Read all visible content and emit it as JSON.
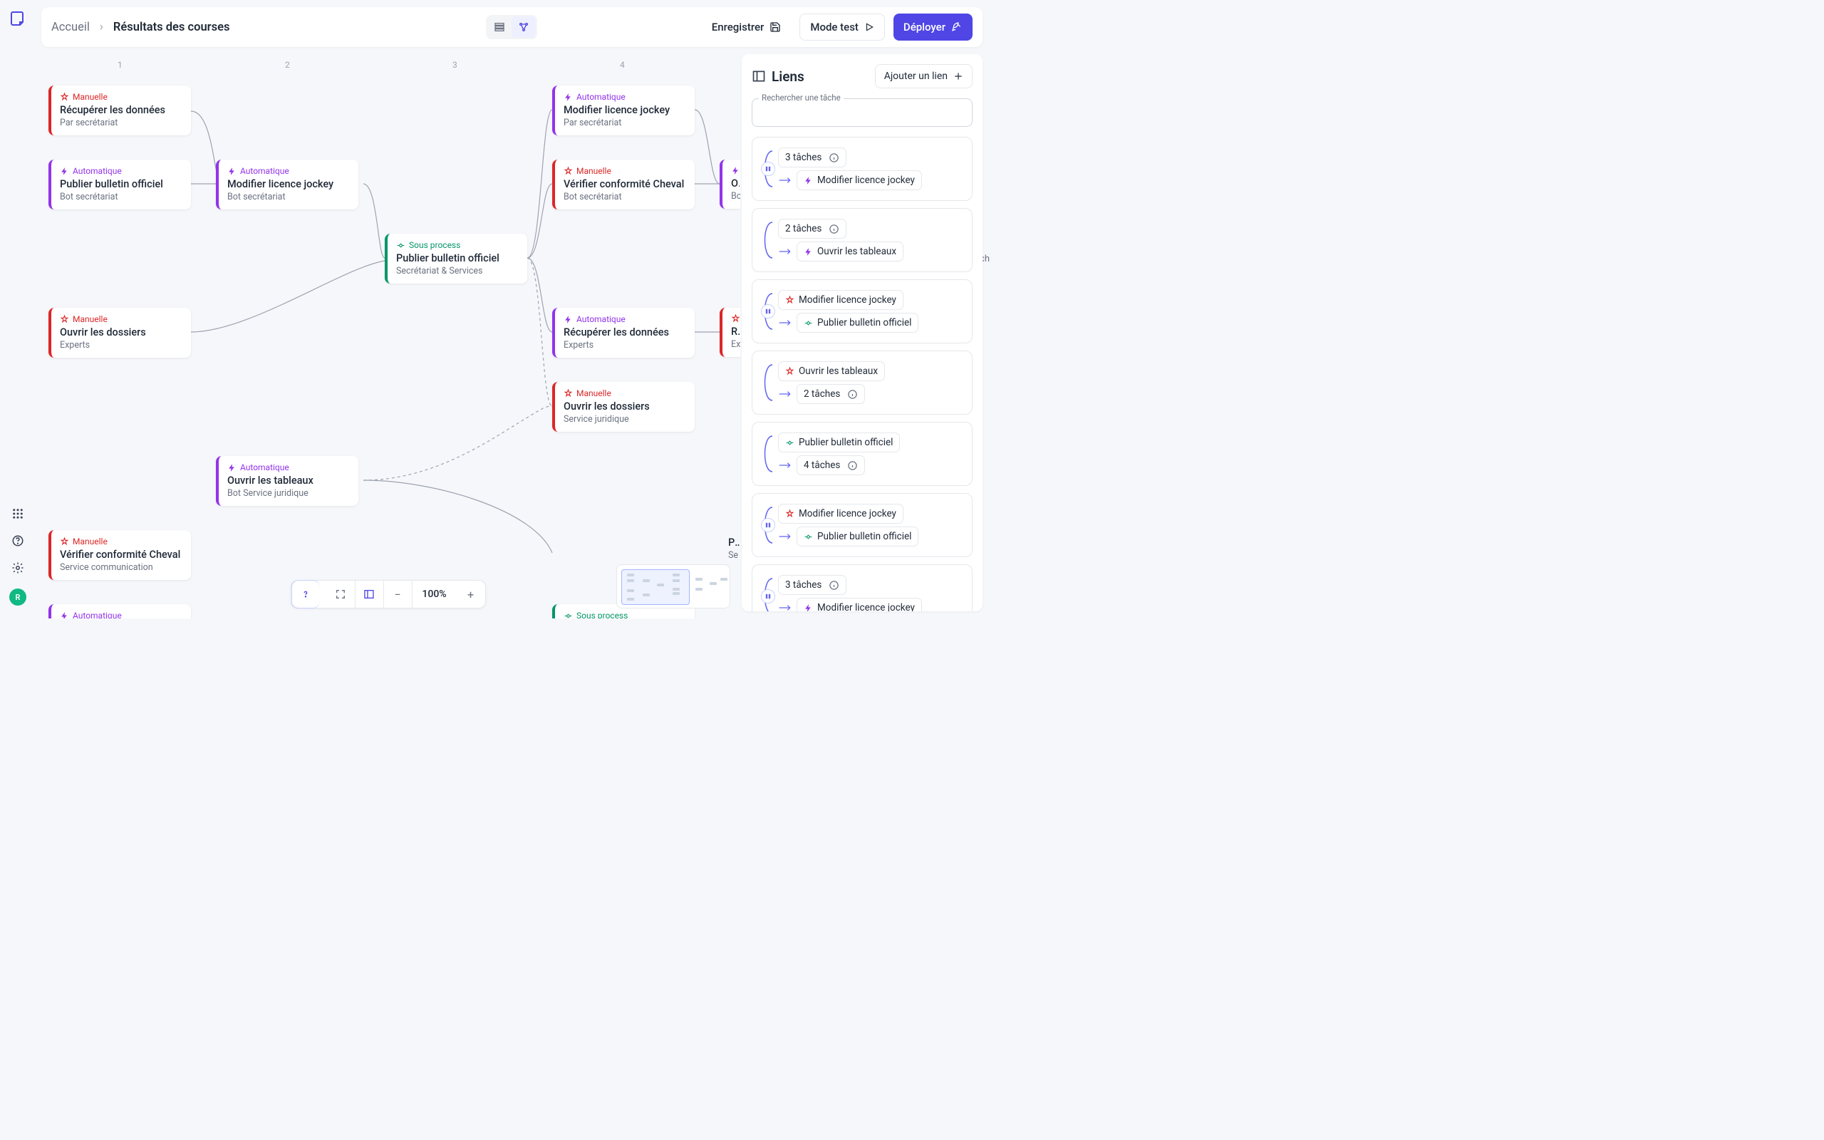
{
  "sidebar": {
    "avatar": "R"
  },
  "header": {
    "home": "Accueil",
    "current": "Résultats des courses",
    "save": "Enregistrer",
    "test": "Mode test",
    "deploy": "Déployer"
  },
  "columns": [
    "1",
    "2",
    "3",
    "4"
  ],
  "tags": {
    "manual": "Manuelle",
    "auto": "Automatique",
    "sub": "Sous process"
  },
  "nodes": {
    "n1": {
      "title": "Récupérer les données",
      "sub": "Par secrétariat"
    },
    "n2": {
      "title": "Publier bulletin officiel",
      "sub": "Bot secrétariat"
    },
    "n3": {
      "title": "Ouvrir les dossiers",
      "sub": "Experts"
    },
    "n4": {
      "title": "Vérifier conformité Cheval",
      "sub": "Service communication"
    },
    "n5": {
      "title": "Modifier licence jockey",
      "sub": "Bot secrétariat"
    },
    "n6": {
      "title": "Ouvrir les tableaux",
      "sub": "Bot Service juridique"
    },
    "n7": {
      "title": "Publier bulletin officiel",
      "sub": "Secrétariat & Services"
    },
    "n8": {
      "title": "Modifier licence jockey",
      "sub": "Par secrétariat"
    },
    "n9": {
      "title": "Vérifier conformité Cheval",
      "sub": "Bot secrétariat"
    },
    "n10": {
      "title": "Récupérer les données",
      "sub": "Experts"
    },
    "n11": {
      "title": "Ouvrir les dossiers",
      "sub": "Service juridique"
    },
    "n12a": {
      "title": "Ou",
      "sub": "Bo"
    },
    "n12b": {
      "title": "Ré",
      "sub": "Ex"
    },
    "n13": {
      "title": "Pu",
      "sub": "Se"
    },
    "n14": "Automatique",
    "n15": "Sous process"
  },
  "panel": {
    "title": "Liens",
    "add": "Ajouter un lien",
    "search": "Rechercher une tâche",
    "links": [
      {
        "pause": true,
        "from": {
          "type": "count",
          "text": "3 tâches"
        },
        "to": {
          "type": "auto",
          "text": "Modifier licence jockey"
        }
      },
      {
        "pause": false,
        "from": {
          "type": "count",
          "text": "2 tâches"
        },
        "to": {
          "type": "auto",
          "text": "Ouvrir les tableaux"
        }
      },
      {
        "pause": true,
        "from": {
          "type": "manual",
          "text": "Modifier licence jockey"
        },
        "to": {
          "type": "sub",
          "text": "Publier bulletin officiel"
        }
      },
      {
        "pause": false,
        "from": {
          "type": "manual",
          "text": "Ouvrir les tableaux"
        },
        "to": {
          "type": "count",
          "text": "2 tâches"
        }
      },
      {
        "pause": false,
        "from": {
          "type": "sub",
          "text": "Publier bulletin officiel"
        },
        "to": {
          "type": "count",
          "text": "4 tâches"
        }
      },
      {
        "pause": true,
        "from": {
          "type": "manual",
          "text": "Modifier licence jockey"
        },
        "to": {
          "type": "sub",
          "text": "Publier bulletin officiel"
        }
      },
      {
        "pause": true,
        "from": {
          "type": "count",
          "text": "3 tâches"
        },
        "to": {
          "type": "auto",
          "text": "Modifier licence jockey"
        }
      }
    ]
  },
  "zoom": "100%",
  "clipped": "ch"
}
